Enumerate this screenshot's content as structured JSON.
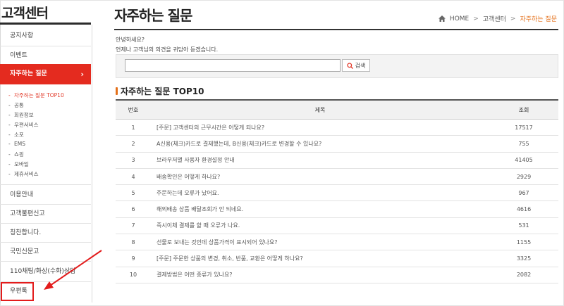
{
  "sidebar": {
    "title": "고객센터",
    "menu": [
      {
        "label": "공지사항"
      },
      {
        "label": "이벤트"
      },
      {
        "label": "자주하는 질문",
        "chevron": "›"
      },
      {
        "label": "이용안내"
      },
      {
        "label": "고객불편신고"
      },
      {
        "label": "칭찬합니다."
      },
      {
        "label": "국민신문고"
      },
      {
        "label": "110채팅/화상(수화)상담"
      },
      {
        "label": "우편톡"
      }
    ],
    "submenu": [
      {
        "label": "자주하는 질문 TOP10"
      },
      {
        "label": "공통"
      },
      {
        "label": "회원정보"
      },
      {
        "label": "우편서비스"
      },
      {
        "label": "소포"
      },
      {
        "label": "EMS"
      },
      {
        "label": "쇼핑"
      },
      {
        "label": "모바일"
      },
      {
        "label": "제휴서비스"
      }
    ],
    "sub_bullet": "-"
  },
  "header": {
    "title": "자주하는 질문",
    "breadcrumb": {
      "home": "HOME",
      "sep": ">",
      "level1": "고객센터",
      "current": "자주하는 질문"
    }
  },
  "intro": {
    "line1": "안녕하세요?",
    "line2": "언제나 고객님의 의견을 귀담아 듣겠습니다."
  },
  "search": {
    "placeholder": "",
    "button_label": "검색"
  },
  "faq": {
    "section_title": "자주하는 질문 TOP10",
    "columns": {
      "num": "번호",
      "subject": "제목",
      "views": "조회"
    },
    "rows": [
      {
        "num": "1",
        "subject": "[주문] 고객센터의 근무시간은 어떻게 되나요?",
        "views": "17517"
      },
      {
        "num": "2",
        "subject": "A신용(체크)카드로 결제했는데, B신용(체크)카드로 변경할 수 있나요?",
        "views": "755"
      },
      {
        "num": "3",
        "subject": "브라우저별 사용자 환경설정 안내",
        "views": "41405"
      },
      {
        "num": "4",
        "subject": "배송확인은 어떻게 하나요?",
        "views": "2929"
      },
      {
        "num": "5",
        "subject": "주문하는데 오류가 났어요.",
        "views": "967"
      },
      {
        "num": "6",
        "subject": "해외배송 상품 배달조회가 안 되네요.",
        "views": "4616"
      },
      {
        "num": "7",
        "subject": "즉시이체 결제를 할 때 오류가 나요.",
        "views": "531"
      },
      {
        "num": "8",
        "subject": "선물로 보내는 것인데 상품가격이 표시되어 있나요?",
        "views": "1155"
      },
      {
        "num": "9",
        "subject": "[주문] 주문한 상품의 변경, 취소, 반품, 교환은 어떻게 하나요?",
        "views": "3325"
      },
      {
        "num": "10",
        "subject": "결제방법은 어떤 종류가 있나요?",
        "views": "2082"
      }
    ]
  },
  "colors": {
    "accent": "#e42b1f",
    "breadcrumb_current": "#e4701a",
    "annotation": "#e31c1c"
  },
  "icons": {
    "home": "home-icon",
    "search": "search-icon",
    "chevron": "chevron-right-icon"
  }
}
